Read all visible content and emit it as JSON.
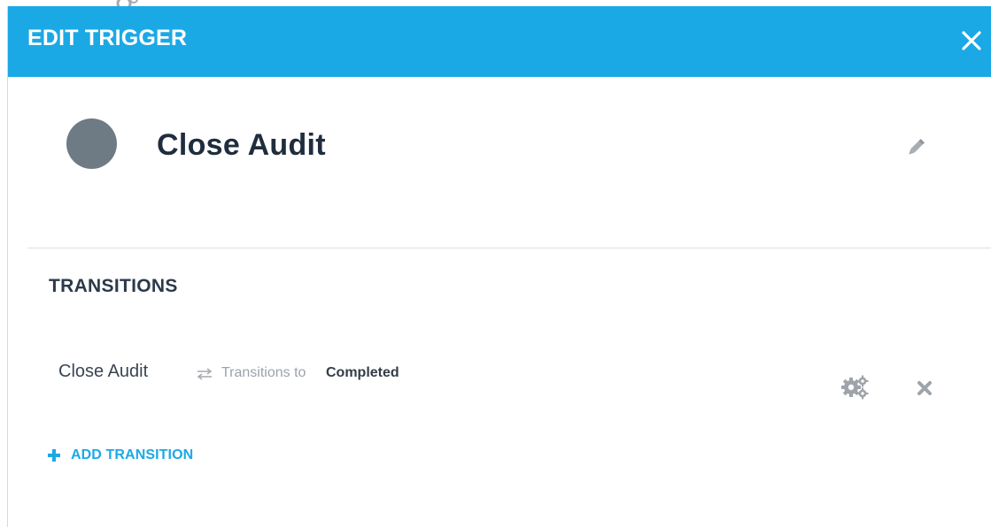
{
  "modal": {
    "title": "EDIT TRIGGER",
    "close_icon": "close-icon"
  },
  "trigger": {
    "name": "Close Audit",
    "status_color": "#6e7b85",
    "edit_icon": "pencil-icon"
  },
  "transitions": {
    "section_title": "TRANSITIONS",
    "items": [
      {
        "name": "Close Audit",
        "connector_icon": "swap-arrows-icon",
        "connector_text": "Transitions to",
        "target": "Completed",
        "settings_icon": "gears-icon",
        "delete_icon": "delete-icon"
      }
    ],
    "add_label": "ADD TRANSITION",
    "add_icon": "plus-icon"
  },
  "colors": {
    "header": "#1ba9e6",
    "accent": "#1ba9e6"
  }
}
